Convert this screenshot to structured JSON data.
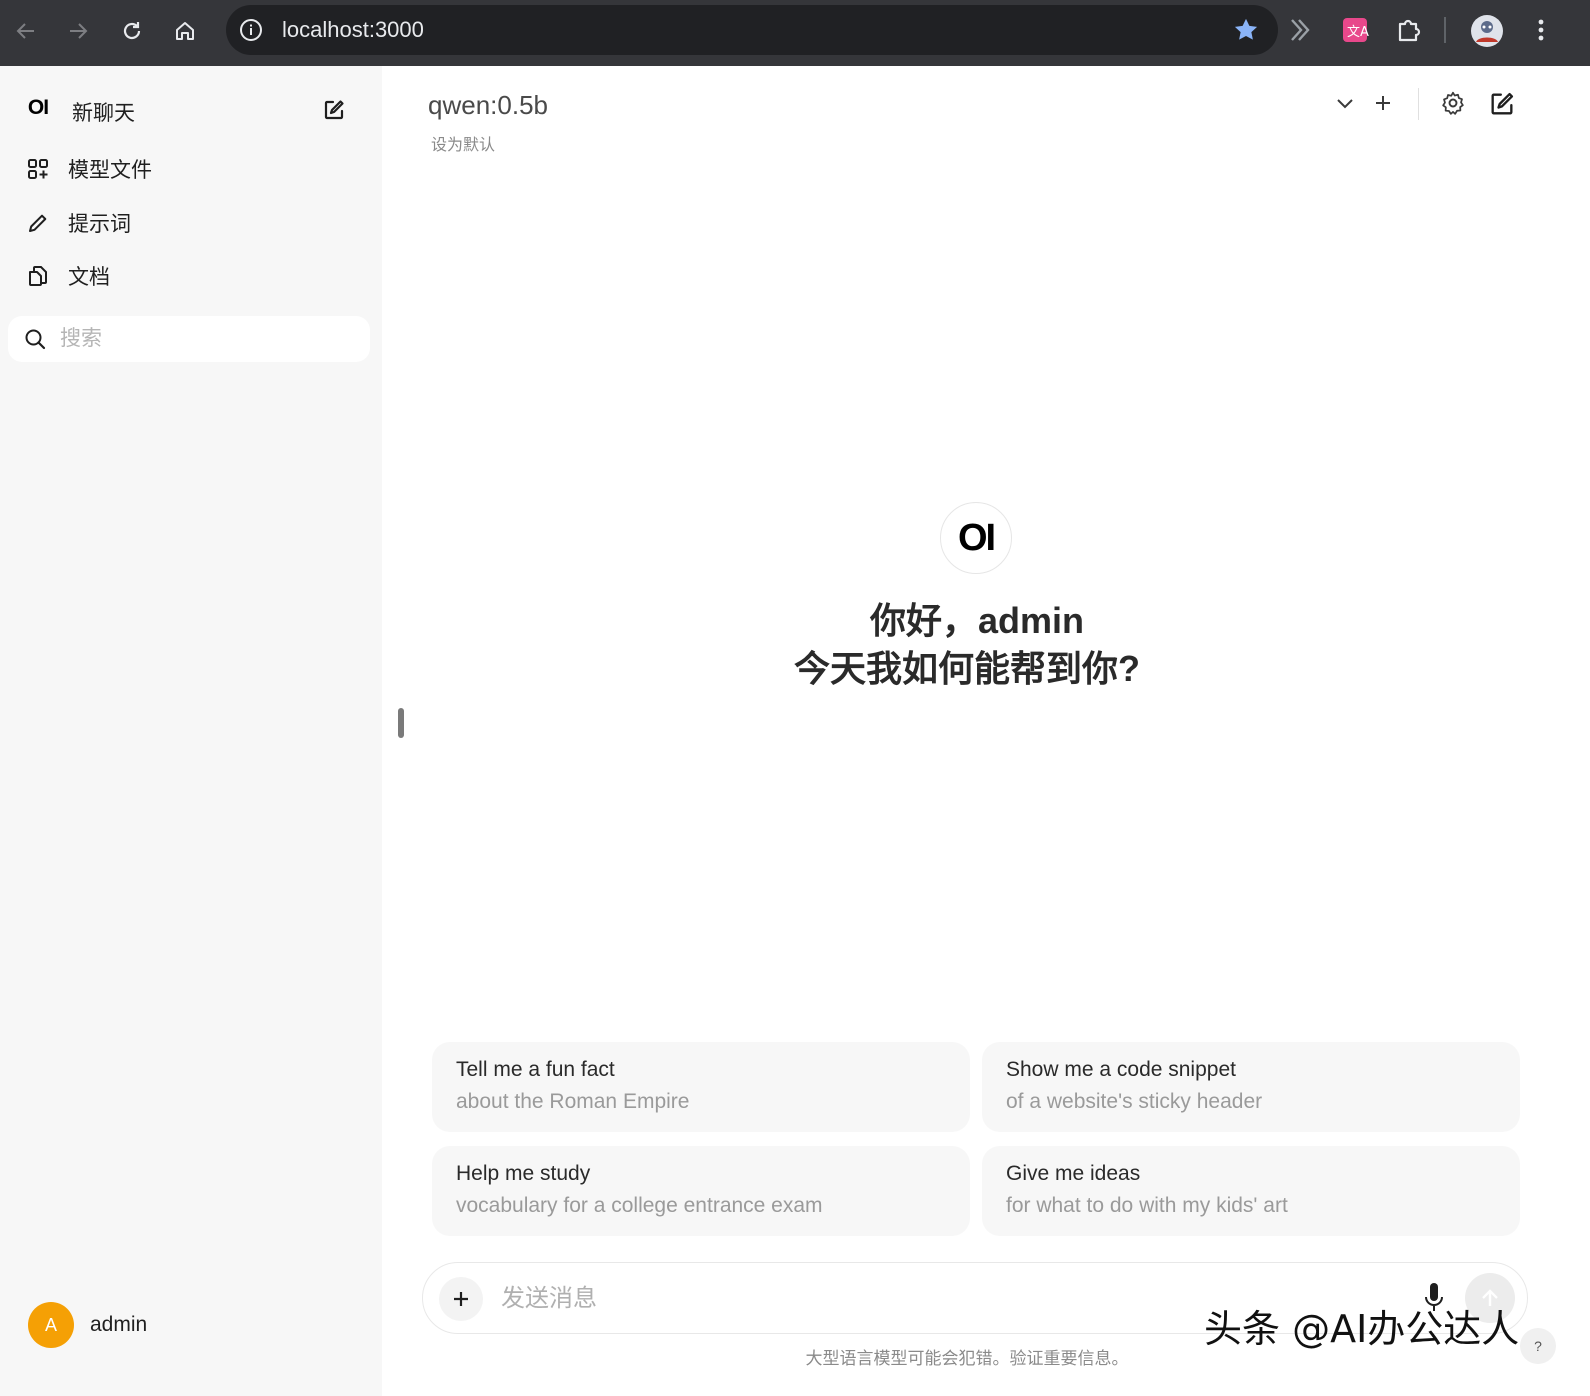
{
  "browser": {
    "url": "localhost:3000",
    "icons": [
      "back-arrow-icon",
      "forward-arrow-icon",
      "reload-icon",
      "home-icon",
      "info-icon",
      "bookmark-star-icon",
      "chevrons-extension-icon",
      "translate-extension-icon",
      "puzzle-extension-icon",
      "profile-avatar-icon",
      "kebab-menu-icon"
    ],
    "colors": {
      "chrome_bg": "#35363a",
      "omnibox_bg": "#202124",
      "star": "#8ab4f8",
      "translate_ext": "#e8488b"
    }
  },
  "sidebar": {
    "logo": "OI",
    "new_chat_label": "新聊天",
    "items": [
      {
        "label": "模型文件",
        "icon": "grid-plus-icon"
      },
      {
        "label": "提示词",
        "icon": "pencil-icon"
      },
      {
        "label": "文档",
        "icon": "documents-icon"
      }
    ],
    "search_placeholder": "搜索",
    "user": {
      "initial": "A",
      "name": "admin",
      "avatar_color": "#f5a005"
    }
  },
  "header": {
    "model_name": "qwen:0.5b",
    "set_default": "设为默认"
  },
  "hero": {
    "logo": "OI",
    "greeting_line1": "你好，admin",
    "greeting_line2": "今天我如何能帮到你?"
  },
  "suggestions": [
    {
      "title": "Tell me a fun fact",
      "subtitle": "about the Roman Empire"
    },
    {
      "title": "Show me a code snippet",
      "subtitle": "of a website's sticky header"
    },
    {
      "title": "Help me study",
      "subtitle": "vocabulary for a college entrance exam"
    },
    {
      "title": "Give me ideas",
      "subtitle": "for what to do with my kids' art"
    }
  ],
  "composer": {
    "placeholder": "发送消息",
    "disclaimer": "大型语言模型可能会犯错。验证重要信息。",
    "help": "?"
  },
  "watermark": "头条 @AI办公达人"
}
